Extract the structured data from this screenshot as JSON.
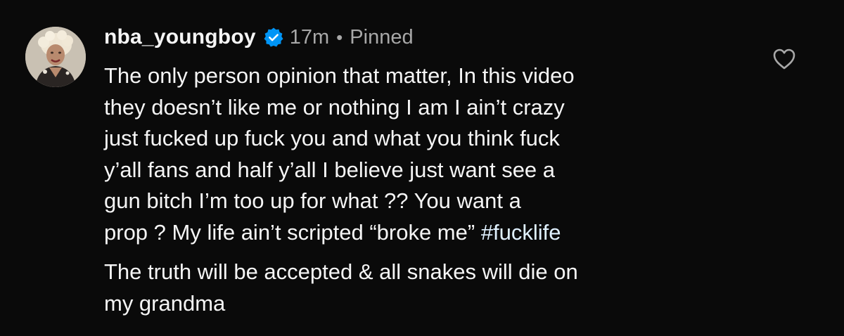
{
  "comment": {
    "username": "nba_youngboy",
    "time": "17m",
    "separator": "•",
    "pinned": "Pinned",
    "paragraph1": {
      "line1": "The only person opinion that matter, In this video",
      "line2": "they doesn’t  like me or nothing I am I ain’t crazy",
      "line3": "just fucked up fuck you and what you think fuck",
      "line4": "y’all fans and half y’all I believe just want see a",
      "line5": "gun bitch I’m too up for what ?? You want a",
      "line6_text": "prop ? My life ain’t scripted “broke me” ",
      "line6_hashtag": "#fucklife"
    },
    "paragraph2": {
      "line1": "The truth will be accepted & all snakes will die on",
      "line2": "my grandma"
    }
  },
  "icons": {
    "verified": "verified-badge-icon",
    "like": "heart-icon",
    "avatar": "profile-avatar"
  },
  "colors": {
    "background": "#0a0a0a",
    "text": "#f5f5f5",
    "meta": "#a8a8a8",
    "verified": "#0095f6",
    "hashtag": "#e0f1ff"
  }
}
